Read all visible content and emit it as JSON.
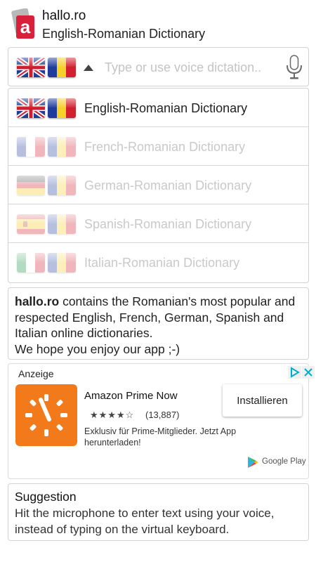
{
  "header": {
    "title": "hallo.ro",
    "subtitle": "English-Romanian Dictionary",
    "logo_letter": "a"
  },
  "search": {
    "placeholder": "Type or use voice dictation..",
    "value": "",
    "source_flag": "uk-flag",
    "target_flag": "romania-flag"
  },
  "dictionaries": [
    {
      "label": "English-Romanian Dictionary",
      "flag": "uk-flag",
      "active": true
    },
    {
      "label": "French-Romanian Dictionary",
      "flag": "france-flag",
      "active": false
    },
    {
      "label": "German-Romanian Dictionary",
      "flag": "germany-flag",
      "active": false
    },
    {
      "label": "Spanish-Romanian Dictionary",
      "flag": "spain-flag",
      "active": false
    },
    {
      "label": "Italian-Romanian Dictionary",
      "flag": "italy-flag",
      "active": false
    }
  ],
  "info": {
    "brand": "hallo.ro",
    "text": " contains the Romanian's most popular and respected English, French, German, Spanish and Italian online dictionaries.",
    "closing": "We hope you enjoy our app ;-)"
  },
  "ad": {
    "label": "Anzeige",
    "app_name": "Amazon Prime Now",
    "stars": "★★★★☆",
    "rating": 4,
    "reviews": "(13,887)",
    "description": "Exklusiv für Prime-Mitglieder. Jetzt App herunterladen!",
    "install_label": "Installieren",
    "store": "Google Play"
  },
  "suggestion": {
    "title": "Suggestion",
    "text": "Hit the microphone to enter text using your voice, instead of typing on the virtual keyboard."
  },
  "colors": {
    "logo_red": "#d8203b",
    "ad_icon_orange": "#f27a1a",
    "border": "#d2d2d2",
    "inactive_text": "#c9c9c9",
    "adchoices_blue": "#00aecd"
  }
}
